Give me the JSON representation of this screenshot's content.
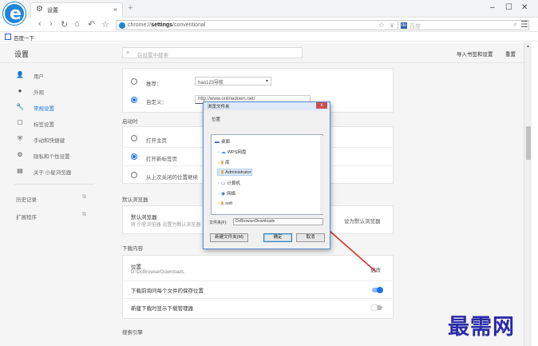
{
  "browser": {
    "tab_title": "设置",
    "new_tab_glyph": "+",
    "address_prefix": "chrome://",
    "address_host": "settings",
    "address_path": "/conventional",
    "search_placeholder": "百度",
    "bookmark_label": "百度一下"
  },
  "settings": {
    "header_title": "设置",
    "search_placeholder": "在设置中搜索",
    "header_links": [
      "导入书签和设置",
      "重置"
    ],
    "sidebar": [
      {
        "icon": "user-icon",
        "glyph": "👤",
        "label": "用户"
      },
      {
        "icon": "palette-icon",
        "glyph": "●",
        "label": "外观"
      },
      {
        "icon": "wrench-icon",
        "glyph": "🔧",
        "label": "常规设置"
      },
      {
        "icon": "window-icon",
        "glyph": "☐",
        "label": "标签设置"
      },
      {
        "icon": "shield-icon",
        "glyph": "⛨",
        "label": "手动和快捷键"
      },
      {
        "icon": "settings-icon",
        "glyph": "⚙",
        "label": "隐私和个性设置"
      },
      {
        "icon": "clipboard-icon",
        "glyph": "▤",
        "label": "关于 小星浏览器"
      },
      {
        "icon": "history-icon",
        "glyph": "",
        "label": "历史记录"
      },
      {
        "icon": "extension-icon",
        "glyph": "",
        "label": "扩展程序"
      }
    ],
    "homepage": {
      "option_recommend": "推荐：",
      "recommend_value": "hao123导航",
      "option_custom": "自定义：",
      "custom_value": "http://www.onlinedown.net/"
    },
    "startup": {
      "section": "启动时",
      "options": [
        "打开主页",
        "打开新标签页",
        "从上次关闭的位置继续"
      ]
    },
    "default_browser": {
      "section": "默认浏览器",
      "title": "默认浏览器",
      "desc": "将 小星浏览器 设置为默认浏览器",
      "action": "设为默认浏览器"
    },
    "downloads": {
      "section": "下载内容",
      "location_label": "位置",
      "location_value": "D:\\DcBrowserDownloads",
      "change": "更改",
      "ask_label": "下载前询问每个文件的保存位置",
      "manager_label": "新建下载时显示下载管理器"
    },
    "search_engine": {
      "section": "搜索引擎"
    }
  },
  "dialog": {
    "title": "浏览文件夹",
    "close": "x",
    "description": "位置",
    "tree": [
      {
        "label": "桌面",
        "icon": "desktop-icon",
        "glyph": "▬",
        "color": "#3a6fb5",
        "level": 0,
        "arrow": ""
      },
      {
        "label": "WPS网盘",
        "icon": "cloud-icon",
        "glyph": "☁",
        "color": "#4a8ad8",
        "level": 1,
        "arrow": "›"
      },
      {
        "label": "库",
        "icon": "library-icon",
        "glyph": "▮",
        "color": "#d6a530",
        "level": 1,
        "arrow": "›"
      },
      {
        "label": "Administrator",
        "icon": "user-folder-icon",
        "glyph": "▮",
        "color": "#d6a530",
        "level": 1,
        "arrow": "›"
      },
      {
        "label": "计算机",
        "icon": "computer-icon",
        "glyph": "▭",
        "color": "#3a6fb5",
        "level": 1,
        "arrow": "›"
      },
      {
        "label": "网络",
        "icon": "network-icon",
        "glyph": "◉",
        "color": "#3a6fb5",
        "level": 1,
        "arrow": "›"
      },
      {
        "label": "soft",
        "icon": "folder-icon",
        "glyph": "▮",
        "color": "#d6a530",
        "level": 1,
        "arrow": "›"
      }
    ],
    "folder_label": "文件夹(F):",
    "folder_value": "DcBrowserDownloads",
    "new_folder": "新建文件夹(M)",
    "ok": "确定",
    "cancel": "取消"
  },
  "watermark": "最需网",
  "colors": {
    "accent": "#1a73e8",
    "annotation_arrow": "#d9302c",
    "brand": "#1d86d8"
  }
}
